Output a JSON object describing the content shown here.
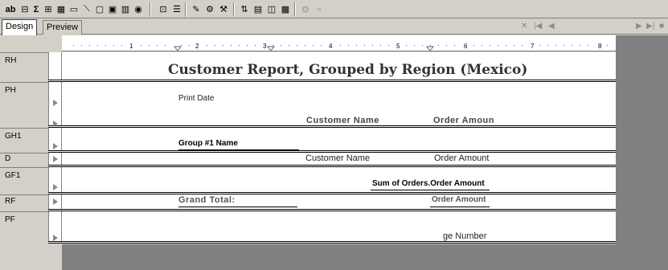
{
  "toolbar": {
    "items": [
      {
        "name": "text-object-icon",
        "label": "ab"
      },
      {
        "name": "field-icon",
        "label": "⊟"
      },
      {
        "name": "summary-icon",
        "label": "Σ"
      },
      {
        "name": "group-icon",
        "label": "⊞"
      },
      {
        "name": "cross-tab-icon",
        "label": "▦"
      },
      {
        "name": "ole-icon",
        "label": "▭"
      },
      {
        "name": "line-icon",
        "label": "⟍"
      },
      {
        "name": "box-icon",
        "label": "▢"
      },
      {
        "name": "picture-icon",
        "label": "▣"
      },
      {
        "name": "chart-icon",
        "label": "▥"
      },
      {
        "name": "map-icon",
        "label": "◉"
      },
      {
        "name": "insert-subreport-icon",
        "label": "⊡"
      },
      {
        "name": "align-icon",
        "label": "☰"
      },
      {
        "name": "format-painter-icon",
        "label": "✎"
      },
      {
        "name": "select-expert-icon",
        "label": "⚙"
      },
      {
        "name": "formula-icon",
        "label": "⚒"
      },
      {
        "name": "sort-icon",
        "label": "⇅"
      },
      {
        "name": "report-explorer-icon",
        "label": "▤"
      },
      {
        "name": "field-explorer-icon",
        "label": "◫"
      },
      {
        "name": "group-tree-icon",
        "label": "▩"
      },
      {
        "name": "find-icon",
        "label": "⊙"
      },
      {
        "name": "close-icon",
        "label": "▫"
      }
    ]
  },
  "tabs": {
    "design": "Design",
    "preview": "Preview"
  },
  "nav": {
    "close": "✕",
    "first": "|◀",
    "prev": "◀",
    "next": "▶",
    "last": "▶|",
    "stop": "■"
  },
  "ruler": {
    "numbers": [
      "1",
      "2",
      "3",
      "4",
      "5",
      "6",
      "7",
      "8"
    ]
  },
  "sections": {
    "rh": {
      "label": "RH",
      "title": "Customer Report, Grouped by Region (Mexico)"
    },
    "ph": {
      "label": "PH",
      "print_date": "Print Date",
      "customer_name": "Customer Name",
      "order_amount": "Order Amoun"
    },
    "gh1": {
      "label": "GH1",
      "group_name": "Group #1 Name"
    },
    "d": {
      "label": "D",
      "customer_name": "Customer Name",
      "order_amount": "Order Amount"
    },
    "gf1": {
      "label": "GF1",
      "sum": "Sum of Orders.Order Amount"
    },
    "rf": {
      "label": "RF",
      "grand_total": "Grand Total:",
      "order_amount": "Order Amount"
    },
    "pf": {
      "label": "PF",
      "page_number": "ge Number"
    }
  }
}
